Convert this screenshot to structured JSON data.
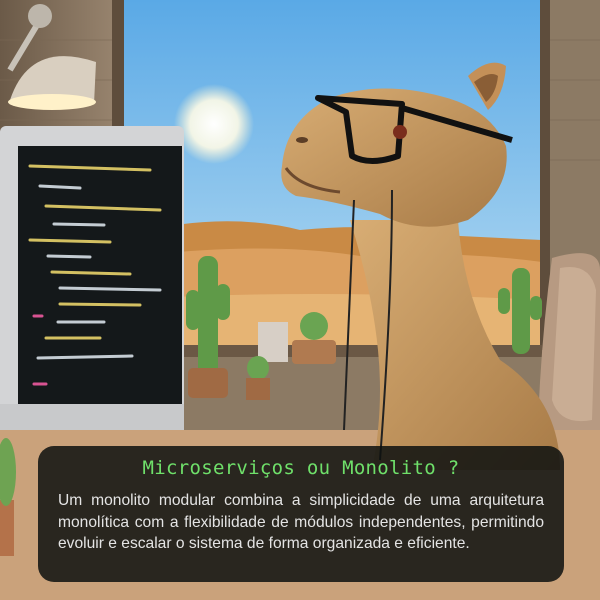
{
  "caption": {
    "title": "Microserviços ou Monolito ?",
    "body": "Um monolito modular combina a simplicidade de uma arquitetura monolítica com a flexibilidade de módulos independentes, permitindo evoluir e escalar o sistema de forma organizada e eficiente."
  },
  "palette": {
    "sky": "#7cc0ec",
    "sand": "#d79a55",
    "camel_fur": "#c9995f",
    "code_keyword": "#e8d36a",
    "code_accent": "#ef5aa0",
    "title_green": "#6fe06a",
    "panel_bg": "#0e1210"
  },
  "icons": [
    "desk-lamp-icon",
    "cactus-icon",
    "monitor-icon",
    "glasses-icon",
    "sun-icon"
  ]
}
